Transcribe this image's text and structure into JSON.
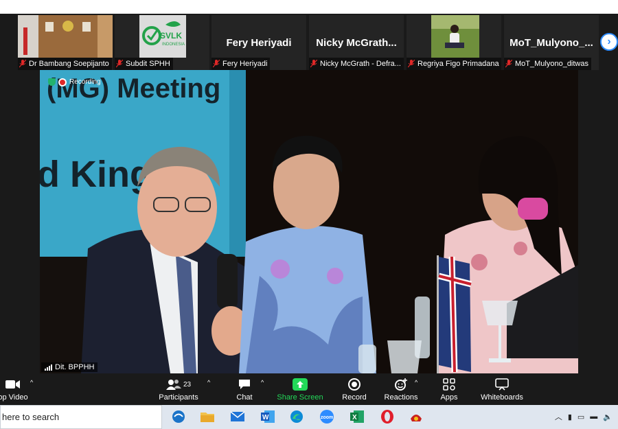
{
  "participants_gallery": [
    {
      "display_name": "",
      "label": "Dr Bambang Soepijanto",
      "has_video": true,
      "mic_muted": true
    },
    {
      "display_name": "",
      "label": "Subdit SPHH",
      "has_video": true,
      "mic_muted": true,
      "logo_text": "SVLK",
      "logo_sub": "INDONESIA"
    },
    {
      "display_name": "Fery Heriyadi",
      "label": "Fery Heriyadi",
      "has_video": false,
      "mic_muted": true
    },
    {
      "display_name": "Nicky  McGrath...",
      "label": "Nicky McGrath - Defra...",
      "has_video": false,
      "mic_muted": true
    },
    {
      "display_name": "",
      "label": "Regriya Figo Primadana",
      "has_video": true,
      "mic_muted": true
    },
    {
      "display_name": "MoT_Mulyono_...",
      "label": "MoT_Mulyono_ditwas",
      "has_video": false,
      "mic_muted": true
    }
  ],
  "gallery_next_icon": "chevron-right-icon",
  "recording": {
    "label": "Recording"
  },
  "active_speaker": {
    "label": "Dit. BPPHH"
  },
  "banner_text": {
    "line1": "(MG) Meeting",
    "line2": "d Kingd"
  },
  "toolbar": {
    "video_label": "op Video",
    "participants_label": "Participants",
    "participants_count": "23",
    "chat_label": "Chat",
    "share_label": "Share Screen",
    "record_label": "Record",
    "reactions_label": "Reactions",
    "apps_label": "Apps",
    "whiteboards_label": "Whiteboards"
  },
  "taskbar": {
    "search_text": "here to search",
    "zoom_app_text": "zoom",
    "apps": [
      "edge-legacy-icon",
      "file-explorer-icon",
      "mail-icon",
      "word-icon",
      "edge-icon",
      "zoom-icon",
      "excel-icon",
      "opera-icon",
      "app-icon"
    ]
  },
  "colors": {
    "accent": "#2d8cff",
    "share_green": "#23d959",
    "taskbar_bg": "#dfe6ef"
  }
}
